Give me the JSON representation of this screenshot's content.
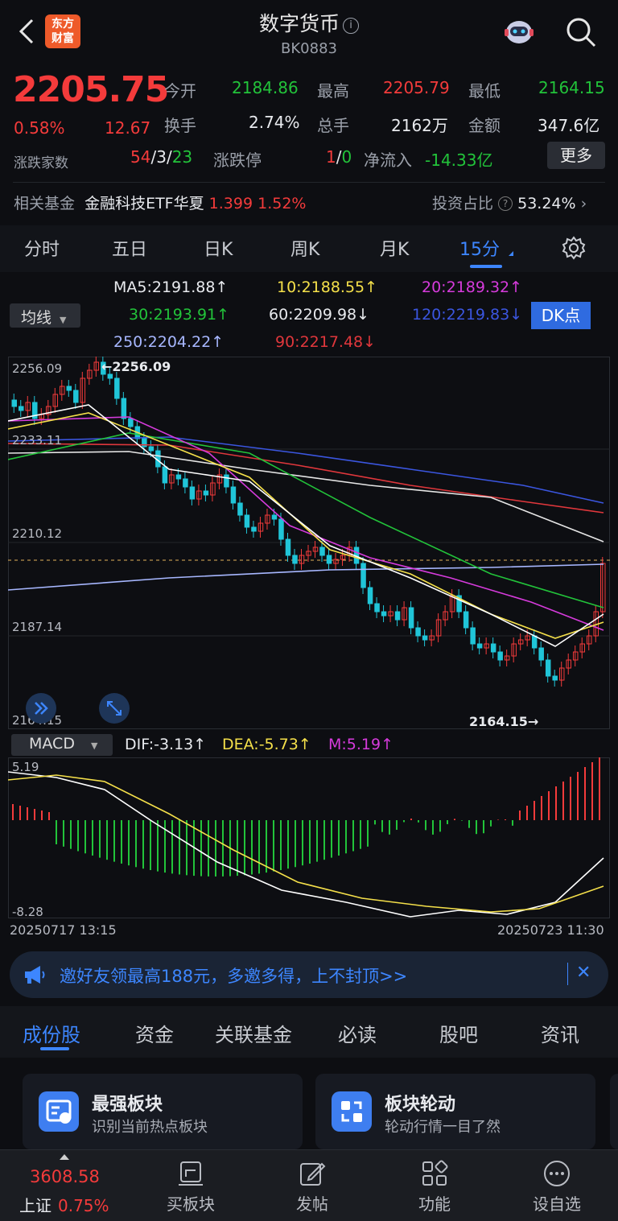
{
  "header": {
    "title": "数字货币",
    "code": "BK0883",
    "logo_text": "东方财富"
  },
  "quote": {
    "price": "2205.75",
    "change_pct": "0.58%",
    "change": "12.67",
    "open_label": "今开",
    "open": "2184.86",
    "high_label": "最高",
    "high": "2205.79",
    "low_label": "最低",
    "low": "2164.15",
    "turnover_label": "换手",
    "turnover": "2.74%",
    "volume_label": "总手",
    "volume": "2162万",
    "amount_label": "金额",
    "amount": "347.6亿",
    "breadth_label": "涨跌家数",
    "breadth_up": "54",
    "breadth_sep1": "/",
    "breadth_flat": "3",
    "breadth_sep2": "/",
    "breadth_down": "23",
    "limit_label": "涨跌停",
    "limit_up": "1",
    "limit_sep": "/",
    "limit_down": "0",
    "netflow_label": "净流入",
    "netflow": "-14.33亿",
    "more_label": "更多"
  },
  "fund": {
    "label": "相关基金",
    "name": "金融科技ETF华夏",
    "price": "1.399",
    "pct": "1.52%",
    "ratio_label": "投资占比",
    "ratio": "53.24%"
  },
  "period_tabs": [
    "分时",
    "五日",
    "日K",
    "周K",
    "月K",
    "15分"
  ],
  "ma": {
    "selector": "均线",
    "ma5": "MA5:2191.88",
    "ma10": "10:2188.55",
    "ma20": "20:2189.32",
    "ma30": "30:2193.91",
    "ma60": "60:2209.98",
    "ma120": "120:2219.83",
    "ma250": "250:2204.22",
    "ma90": "90:2217.48",
    "dk_label": "DK点"
  },
  "axis": {
    "y1": "2256.09",
    "y2": "2233.11",
    "y3": "2210.12",
    "y4": "2187.14",
    "y5": "2164.15",
    "high_mark": "←2256.09",
    "low_mark": "2164.15→"
  },
  "macd": {
    "selector": "MACD",
    "dif": "DIF:-3.13",
    "dea": "DEA:-5.73",
    "m": "M:5.19",
    "top": "5.19",
    "bottom": "-8.28"
  },
  "dates": {
    "start": "20250717 13:15",
    "end": "20250723 11:30"
  },
  "banner": {
    "text": "邀好友领最高188元，多邀多得，上不封顶>>"
  },
  "content_tabs": [
    "成份股",
    "资金",
    "关联基金",
    "必读",
    "股吧",
    "资讯"
  ],
  "cards": [
    {
      "title": "最强板块",
      "desc": "识别当前热点板块"
    },
    {
      "title": "板块轮动",
      "desc": "轮动行情一目了然"
    }
  ],
  "bottom_nav": {
    "index_value": "3608.58",
    "index_name": "上证",
    "index_pct": "0.75%",
    "items": [
      "买板块",
      "发帖",
      "功能",
      "设自选"
    ]
  },
  "colors": {
    "up": "#f43b3b",
    "down": "#22c33a",
    "accent": "#3d86ff"
  }
}
